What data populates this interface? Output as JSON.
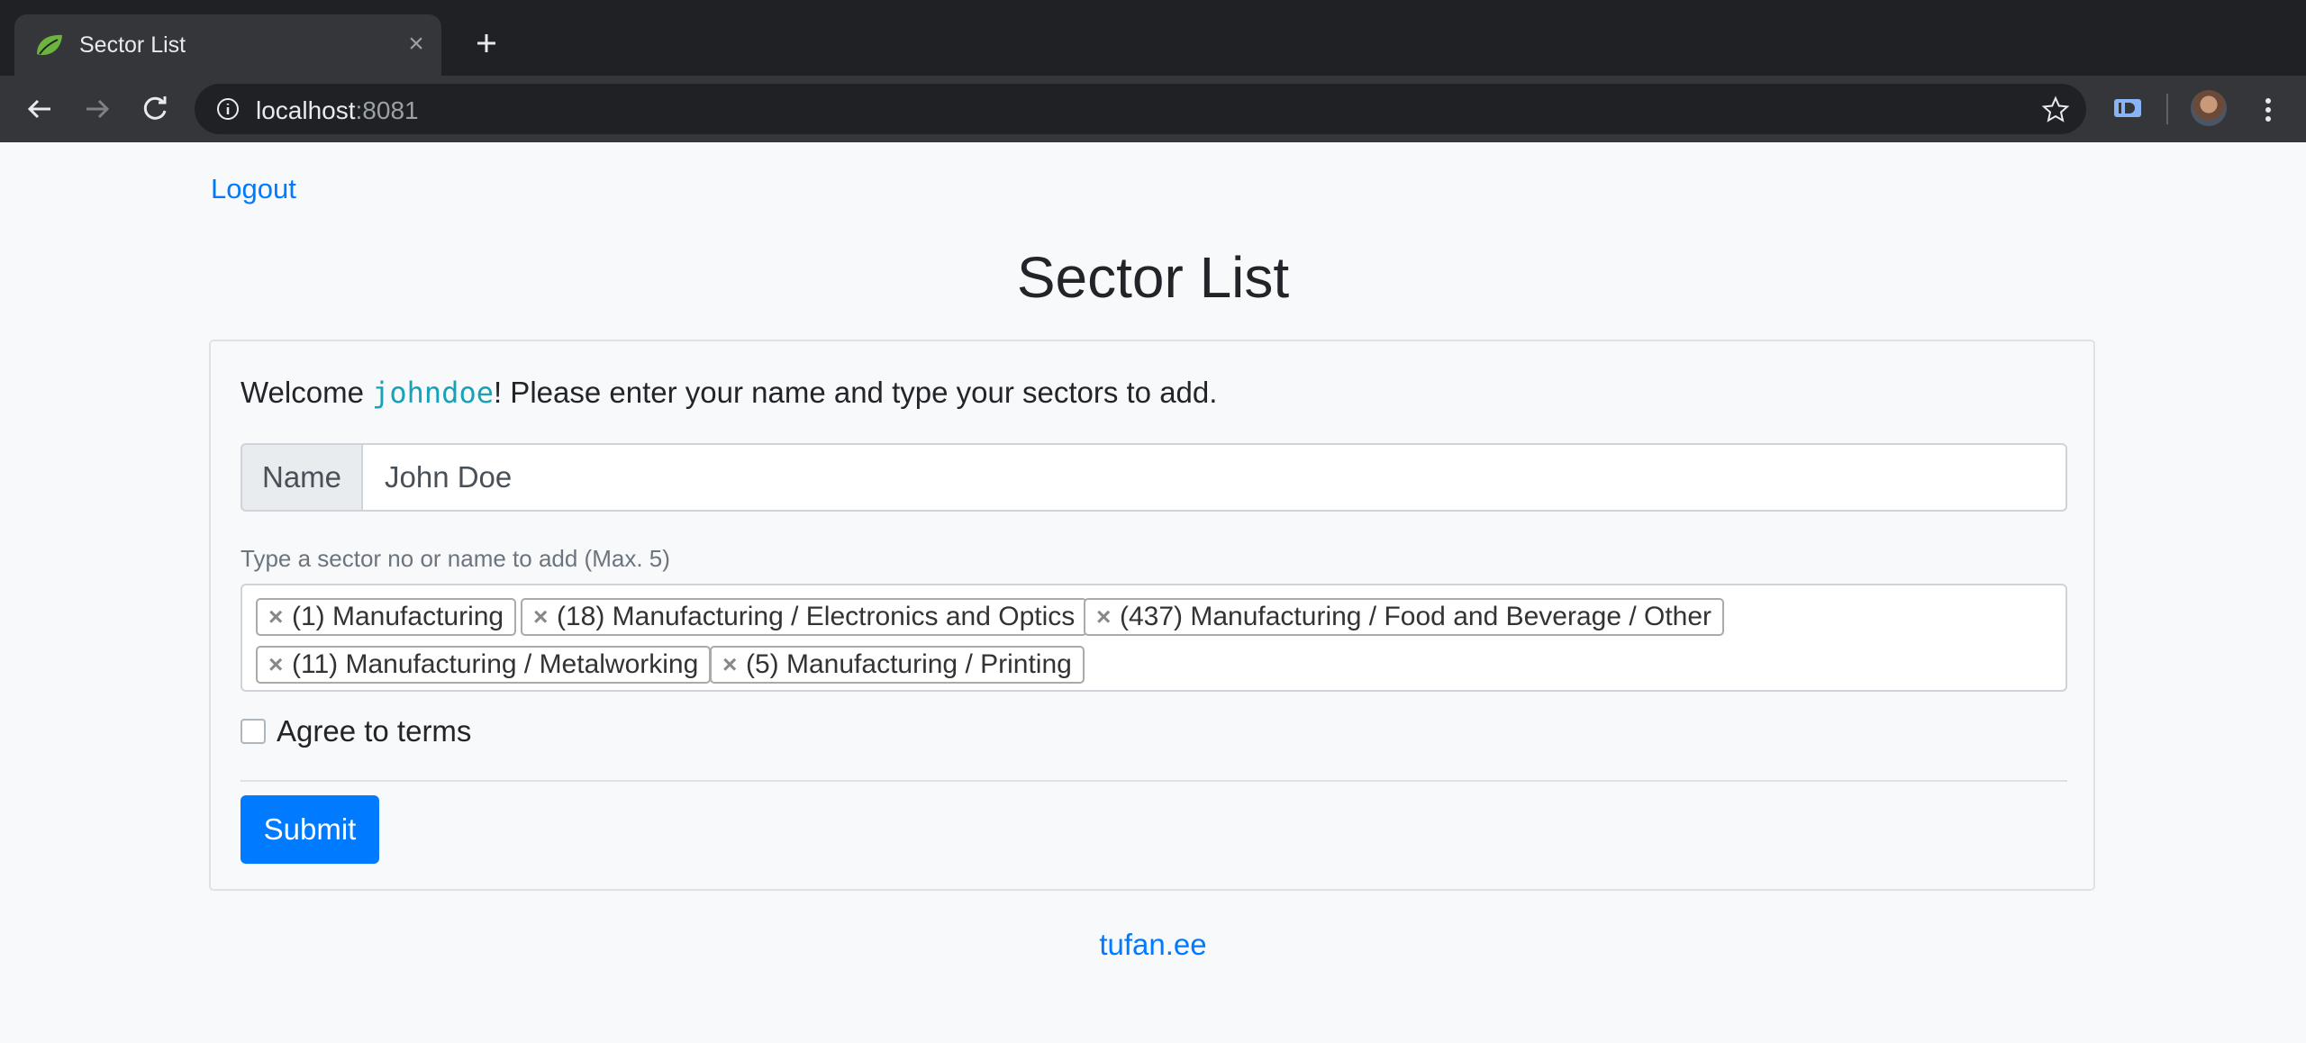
{
  "browser": {
    "tab_title": "Sector List",
    "url_host": "localhost",
    "url_port": ":8081"
  },
  "page": {
    "logout_label": "Logout",
    "heading": "Sector List",
    "welcome_prefix": "Welcome ",
    "username": "johndoe",
    "welcome_suffix": "! Please enter your name and type your sectors to add.",
    "name_label": "Name",
    "name_value": "John Doe",
    "sector_help": "Type a sector no or name to add (Max. 5)",
    "sectors": [
      "(1) Manufacturing",
      "(18) Manufacturing / Electronics and Optics",
      "(437) Manufacturing / Food and Beverage / Other",
      "(11) Manufacturing / Metalworking",
      "(5) Manufacturing / Printing"
    ],
    "tag_remove_symbol": "×",
    "agree_label": "Agree to terms",
    "agree_checked": false,
    "submit_label": "Submit",
    "footer_link": "tufan.ee"
  },
  "colors": {
    "link": "#007bff",
    "primary_button": "#007bff",
    "username_code": "#17a2b8"
  }
}
